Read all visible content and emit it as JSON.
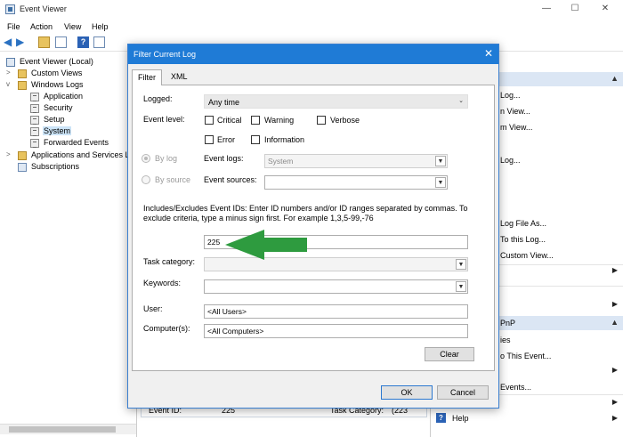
{
  "app": {
    "title": "Event Viewer"
  },
  "window_controls": {
    "minimize": "—",
    "maximize": "☐",
    "close": "✕"
  },
  "menu": [
    "File",
    "Action",
    "View",
    "Help"
  ],
  "tree": {
    "root": "Event Viewer (Local)",
    "custom_views": "Custom Views",
    "windows_logs": "Windows Logs",
    "logs": [
      "Application",
      "Security",
      "Setup",
      "System",
      "Forwarded Events"
    ],
    "apps_services": "Applications and Services L",
    "subscriptions": "Subscriptions"
  },
  "actions": {
    "items_top": [
      "Log...",
      "n View...",
      "m View...",
      "Log...",
      "Log File As...",
      "To this Log...",
      "Custom View..."
    ],
    "section2_header": "PnP",
    "items_bottom": [
      "ies",
      "o This Event...",
      "Events...",
      "Help"
    ]
  },
  "detail": {
    "event_id_label": "Event ID:",
    "event_id_value": "225",
    "task_category_label": "Task Category:",
    "task_category_value": "(223"
  },
  "dialog": {
    "title": "Filter Current Log",
    "close": "✕",
    "tabs": [
      "Filter",
      "XML"
    ],
    "logged_label": "Logged:",
    "logged_value": "Any time",
    "event_level_label": "Event level:",
    "levels": [
      "Critical",
      "Warning",
      "Verbose",
      "Error",
      "Information"
    ],
    "by_log_label": "By log",
    "by_source_label": "By source",
    "event_logs_label": "Event logs:",
    "event_logs_value": "System",
    "event_sources_label": "Event sources:",
    "event_sources_value": "",
    "ids_help": "Includes/Excludes Event IDs: Enter ID numbers and/or ID ranges separated by commas. To exclude criteria, type a minus sign first. For example 1,3,5-99,-76",
    "event_ids_value": "225",
    "task_category_label": "Task category:",
    "keywords_label": "Keywords:",
    "user_label": "User:",
    "user_value": "<All Users>",
    "computers_label": "Computer(s):",
    "computers_value": "<All Computers>",
    "clear_label": "Clear",
    "ok_label": "OK",
    "cancel_label": "Cancel"
  },
  "colors": {
    "dialog_title": "#1f7bd6",
    "selection": "#cce4f7",
    "annotation_arrow": "#2e9b3f"
  }
}
